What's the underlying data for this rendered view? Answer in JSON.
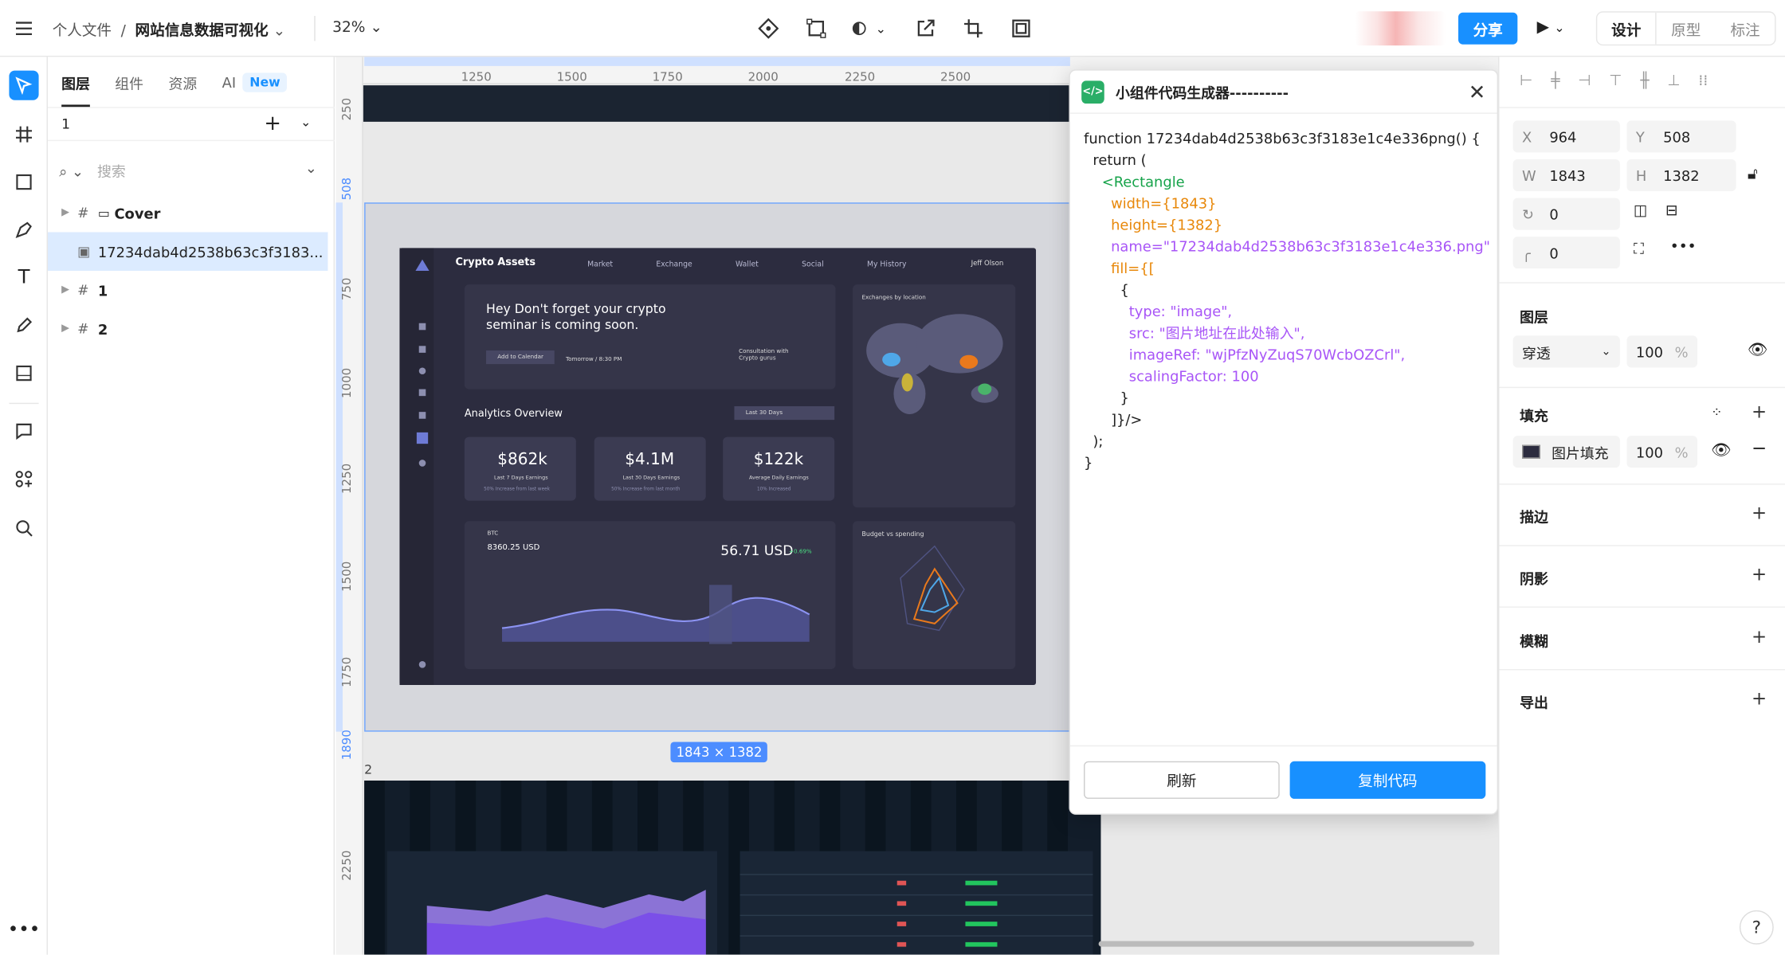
{
  "topbar": {
    "breadcrumb_root": "个人文件",
    "breadcrumb_sep": "/",
    "breadcrumb_file": "网站信息数据可视化",
    "zoom": "32%",
    "share": "分享",
    "modes": [
      "设计",
      "原型",
      "标注"
    ]
  },
  "layers_panel": {
    "tabs": [
      "图层",
      "组件",
      "资源",
      "AI"
    ],
    "ai_badge": "New",
    "page_name": "1",
    "search_placeholder": "搜索",
    "tree": [
      {
        "label": "Cover",
        "type": "frame"
      },
      {
        "label": "17234dab4d2538b63c3f3183...",
        "type": "image",
        "selected": true
      },
      {
        "label": "1",
        "type": "frame"
      },
      {
        "label": "2",
        "type": "frame"
      }
    ]
  },
  "canvas": {
    "ruler_top": [
      "1250",
      "1500",
      "1750",
      "2000",
      "2250",
      "2500"
    ],
    "ruler_left": [
      "250",
      "508",
      "750",
      "1000",
      "1250",
      "1500",
      "1750",
      "1890",
      "2",
      "2250"
    ],
    "selection_size": "1843 × 1382",
    "frame_label": "2",
    "dashboard": {
      "title": "Crypto Assets",
      "nav": [
        "Market",
        "Exchange",
        "Wallet",
        "Social",
        "My History"
      ],
      "user": "Jeff Olson",
      "banner": "Hey Don't forget your crypto seminar is coming soon.",
      "banner_btn": "Add to Calendar",
      "banner_time": "Tomorrow / 8:30 PM",
      "consult": "Consultation with Crypto gurus",
      "overview": "Analytics Overview",
      "period": "Last 30 Days",
      "stats": [
        {
          "value": "$862k",
          "label": "Last 7 Days Earnings",
          "sub": "50% Increase from last week"
        },
        {
          "value": "$4.1M",
          "label": "Last 30 Days Earnings",
          "sub": "50% Increase from last month"
        },
        {
          "value": "$122k",
          "label": "Average Daily Earnings",
          "sub": "10% Increased"
        }
      ],
      "btc_label": "BTC",
      "btc_value": "8360.25 USD",
      "usd_value": "56.71 USD",
      "change": "+0.69%",
      "location_title": "Exchanges by location",
      "spend_title": "Budget vs spending"
    }
  },
  "modal": {
    "title": "小组件代码生成器----------",
    "code_lines": [
      "function 17234dab4d2538b63c3f3183e1c4e336png() {",
      "  return (",
      "    <Rectangle",
      "      width={1843}",
      "      height={1382}",
      "      name=\"17234dab4d2538b63c3f3183e1c4e336.png\"",
      "      fill={[",
      "        {",
      "          type: \"image\",",
      "          src: \"图片地址在此处输入\",",
      "          imageRef: \"wjPfzNyZuqS70WcbOZCrl\",",
      "          scalingFactor: 100",
      "        }",
      "      ]}/>",
      "  );",
      "}"
    ],
    "refresh": "刷新",
    "copy": "复制代码"
  },
  "inspector": {
    "x": "964",
    "y": "508",
    "w": "1843",
    "h": "1382",
    "rotation": "0",
    "radius": "0",
    "layer_title": "图层",
    "blend": "穿透",
    "opacity": "100",
    "fill_title": "填充",
    "fill_type": "图片填充",
    "fill_opacity": "100",
    "percent": "%",
    "stroke": "描边",
    "shadow": "阴影",
    "blur": "模糊",
    "export": "导出"
  },
  "help": "?"
}
